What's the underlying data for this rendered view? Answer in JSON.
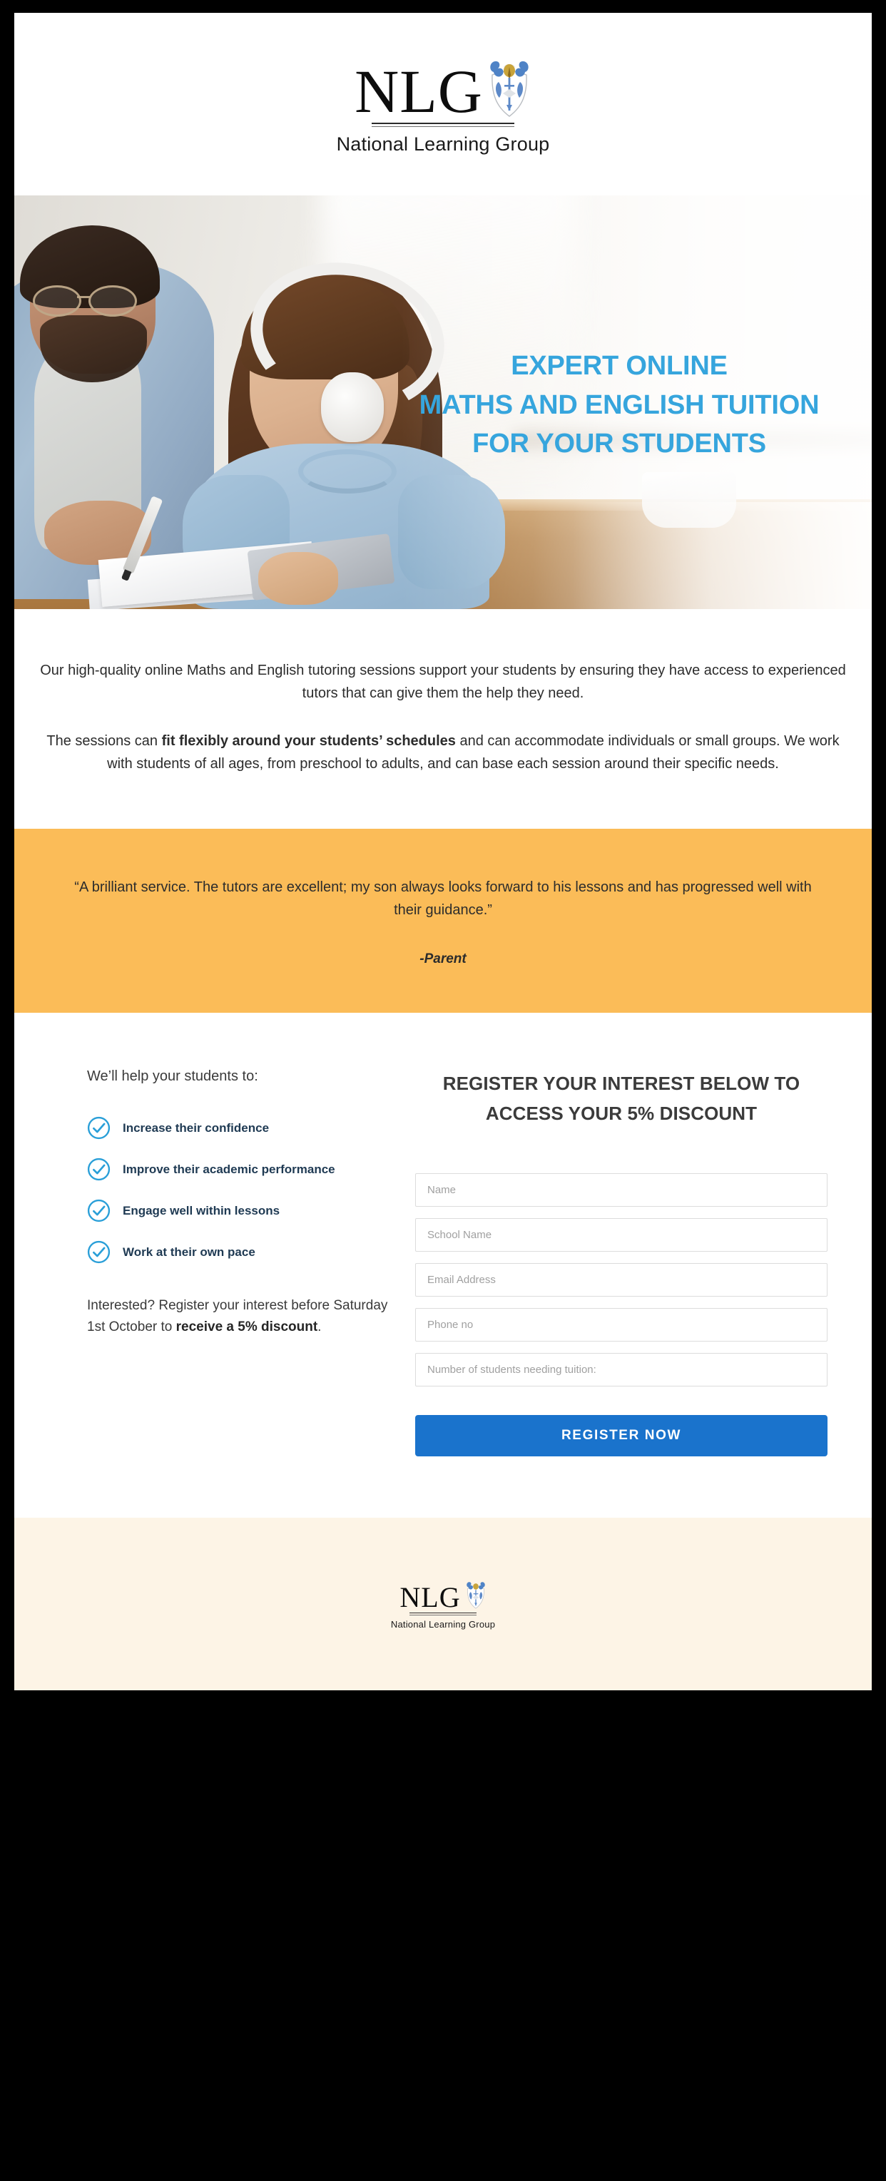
{
  "brand": {
    "logo_letters": "NLG",
    "logo_subtitle": "National Learning Group",
    "crest_icon": "heraldic-crest-icon",
    "accent_blue": "#36a5dd",
    "button_blue": "#1a73cc",
    "testimonial_orange": "#fbbc58",
    "footer_cream": "#fdf4e6"
  },
  "hero": {
    "headline_line1": "EXPERT ONLINE",
    "headline_line2": "MATHS AND ENGLISH TUITION",
    "headline_line3": "FOR YOUR STUDENTS",
    "image_alt": "tutor-and-student-photo"
  },
  "intro": {
    "paragraph1": "Our high-quality online Maths and English tutoring sessions support your students by ensuring they have access to experienced tutors that can give them the help they need.",
    "paragraph2_part1": "The sessions can ",
    "paragraph2_bold": "fit flexibly around your students’ schedules",
    "paragraph2_part2": " and can accommodate individuals or small groups. We work with students of all ages, from preschool to adults, and can base each session around their specific needs."
  },
  "testimonial": {
    "quote": "“A brilliant service. The tutors are excellent; my son always looks forward to his lessons and has progressed well with their guidance.”",
    "attribution": "-Parent"
  },
  "benefits": {
    "lead_in": "We’ll help your students to:",
    "items": [
      {
        "label": "Increase their confidence",
        "icon": "check-circle-icon"
      },
      {
        "label": "Improve their academic performance",
        "icon": "check-circle-icon"
      },
      {
        "label": "Engage well within lessons",
        "icon": "check-circle-icon"
      },
      {
        "label": "Work at their own pace",
        "icon": "check-circle-icon"
      }
    ],
    "note_part1": "Interested? Register your interest before Saturday 1st October to ",
    "note_bold": "receive a 5% discount",
    "note_part2": "."
  },
  "form": {
    "heading": "REGISTER YOUR INTEREST BELOW TO ACCESS YOUR 5% DISCOUNT",
    "fields": [
      {
        "name": "name",
        "placeholder": "Name",
        "value": ""
      },
      {
        "name": "school-name",
        "placeholder": "School Name",
        "value": ""
      },
      {
        "name": "email",
        "placeholder": "Email Address",
        "value": ""
      },
      {
        "name": "phone",
        "placeholder": "Phone no",
        "value": ""
      },
      {
        "name": "student-count",
        "placeholder": "Number of students needing tuition:",
        "value": ""
      }
    ],
    "submit_label": "REGISTER NOW"
  }
}
